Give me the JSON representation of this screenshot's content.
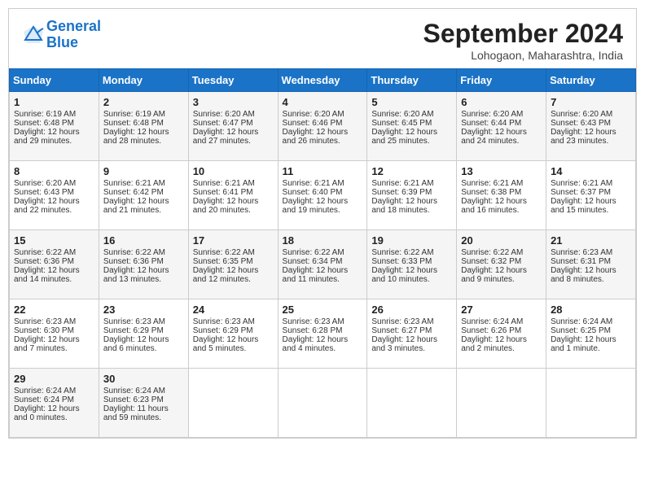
{
  "header": {
    "logo_line1": "General",
    "logo_line2": "Blue",
    "month_title": "September 2024",
    "location": "Lohogaon, Maharashtra, India"
  },
  "weekdays": [
    "Sunday",
    "Monday",
    "Tuesday",
    "Wednesday",
    "Thursday",
    "Friday",
    "Saturday"
  ],
  "weeks": [
    [
      {
        "day": "1",
        "lines": [
          "Sunrise: 6:19 AM",
          "Sunset: 6:48 PM",
          "Daylight: 12 hours",
          "and 29 minutes."
        ]
      },
      {
        "day": "2",
        "lines": [
          "Sunrise: 6:19 AM",
          "Sunset: 6:48 PM",
          "Daylight: 12 hours",
          "and 28 minutes."
        ]
      },
      {
        "day": "3",
        "lines": [
          "Sunrise: 6:20 AM",
          "Sunset: 6:47 PM",
          "Daylight: 12 hours",
          "and 27 minutes."
        ]
      },
      {
        "day": "4",
        "lines": [
          "Sunrise: 6:20 AM",
          "Sunset: 6:46 PM",
          "Daylight: 12 hours",
          "and 26 minutes."
        ]
      },
      {
        "day": "5",
        "lines": [
          "Sunrise: 6:20 AM",
          "Sunset: 6:45 PM",
          "Daylight: 12 hours",
          "and 25 minutes."
        ]
      },
      {
        "day": "6",
        "lines": [
          "Sunrise: 6:20 AM",
          "Sunset: 6:44 PM",
          "Daylight: 12 hours",
          "and 24 minutes."
        ]
      },
      {
        "day": "7",
        "lines": [
          "Sunrise: 6:20 AM",
          "Sunset: 6:43 PM",
          "Daylight: 12 hours",
          "and 23 minutes."
        ]
      }
    ],
    [
      {
        "day": "8",
        "lines": [
          "Sunrise: 6:20 AM",
          "Sunset: 6:43 PM",
          "Daylight: 12 hours",
          "and 22 minutes."
        ]
      },
      {
        "day": "9",
        "lines": [
          "Sunrise: 6:21 AM",
          "Sunset: 6:42 PM",
          "Daylight: 12 hours",
          "and 21 minutes."
        ]
      },
      {
        "day": "10",
        "lines": [
          "Sunrise: 6:21 AM",
          "Sunset: 6:41 PM",
          "Daylight: 12 hours",
          "and 20 minutes."
        ]
      },
      {
        "day": "11",
        "lines": [
          "Sunrise: 6:21 AM",
          "Sunset: 6:40 PM",
          "Daylight: 12 hours",
          "and 19 minutes."
        ]
      },
      {
        "day": "12",
        "lines": [
          "Sunrise: 6:21 AM",
          "Sunset: 6:39 PM",
          "Daylight: 12 hours",
          "and 18 minutes."
        ]
      },
      {
        "day": "13",
        "lines": [
          "Sunrise: 6:21 AM",
          "Sunset: 6:38 PM",
          "Daylight: 12 hours",
          "and 16 minutes."
        ]
      },
      {
        "day": "14",
        "lines": [
          "Sunrise: 6:21 AM",
          "Sunset: 6:37 PM",
          "Daylight: 12 hours",
          "and 15 minutes."
        ]
      }
    ],
    [
      {
        "day": "15",
        "lines": [
          "Sunrise: 6:22 AM",
          "Sunset: 6:36 PM",
          "Daylight: 12 hours",
          "and 14 minutes."
        ]
      },
      {
        "day": "16",
        "lines": [
          "Sunrise: 6:22 AM",
          "Sunset: 6:36 PM",
          "Daylight: 12 hours",
          "and 13 minutes."
        ]
      },
      {
        "day": "17",
        "lines": [
          "Sunrise: 6:22 AM",
          "Sunset: 6:35 PM",
          "Daylight: 12 hours",
          "and 12 minutes."
        ]
      },
      {
        "day": "18",
        "lines": [
          "Sunrise: 6:22 AM",
          "Sunset: 6:34 PM",
          "Daylight: 12 hours",
          "and 11 minutes."
        ]
      },
      {
        "day": "19",
        "lines": [
          "Sunrise: 6:22 AM",
          "Sunset: 6:33 PM",
          "Daylight: 12 hours",
          "and 10 minutes."
        ]
      },
      {
        "day": "20",
        "lines": [
          "Sunrise: 6:22 AM",
          "Sunset: 6:32 PM",
          "Daylight: 12 hours",
          "and 9 minutes."
        ]
      },
      {
        "day": "21",
        "lines": [
          "Sunrise: 6:23 AM",
          "Sunset: 6:31 PM",
          "Daylight: 12 hours",
          "and 8 minutes."
        ]
      }
    ],
    [
      {
        "day": "22",
        "lines": [
          "Sunrise: 6:23 AM",
          "Sunset: 6:30 PM",
          "Daylight: 12 hours",
          "and 7 minutes."
        ]
      },
      {
        "day": "23",
        "lines": [
          "Sunrise: 6:23 AM",
          "Sunset: 6:29 PM",
          "Daylight: 12 hours",
          "and 6 minutes."
        ]
      },
      {
        "day": "24",
        "lines": [
          "Sunrise: 6:23 AM",
          "Sunset: 6:29 PM",
          "Daylight: 12 hours",
          "and 5 minutes."
        ]
      },
      {
        "day": "25",
        "lines": [
          "Sunrise: 6:23 AM",
          "Sunset: 6:28 PM",
          "Daylight: 12 hours",
          "and 4 minutes."
        ]
      },
      {
        "day": "26",
        "lines": [
          "Sunrise: 6:23 AM",
          "Sunset: 6:27 PM",
          "Daylight: 12 hours",
          "and 3 minutes."
        ]
      },
      {
        "day": "27",
        "lines": [
          "Sunrise: 6:24 AM",
          "Sunset: 6:26 PM",
          "Daylight: 12 hours",
          "and 2 minutes."
        ]
      },
      {
        "day": "28",
        "lines": [
          "Sunrise: 6:24 AM",
          "Sunset: 6:25 PM",
          "Daylight: 12 hours",
          "and 1 minute."
        ]
      }
    ],
    [
      {
        "day": "29",
        "lines": [
          "Sunrise: 6:24 AM",
          "Sunset: 6:24 PM",
          "Daylight: 12 hours",
          "and 0 minutes."
        ]
      },
      {
        "day": "30",
        "lines": [
          "Sunrise: 6:24 AM",
          "Sunset: 6:23 PM",
          "Daylight: 11 hours",
          "and 59 minutes."
        ]
      },
      null,
      null,
      null,
      null,
      null
    ]
  ]
}
